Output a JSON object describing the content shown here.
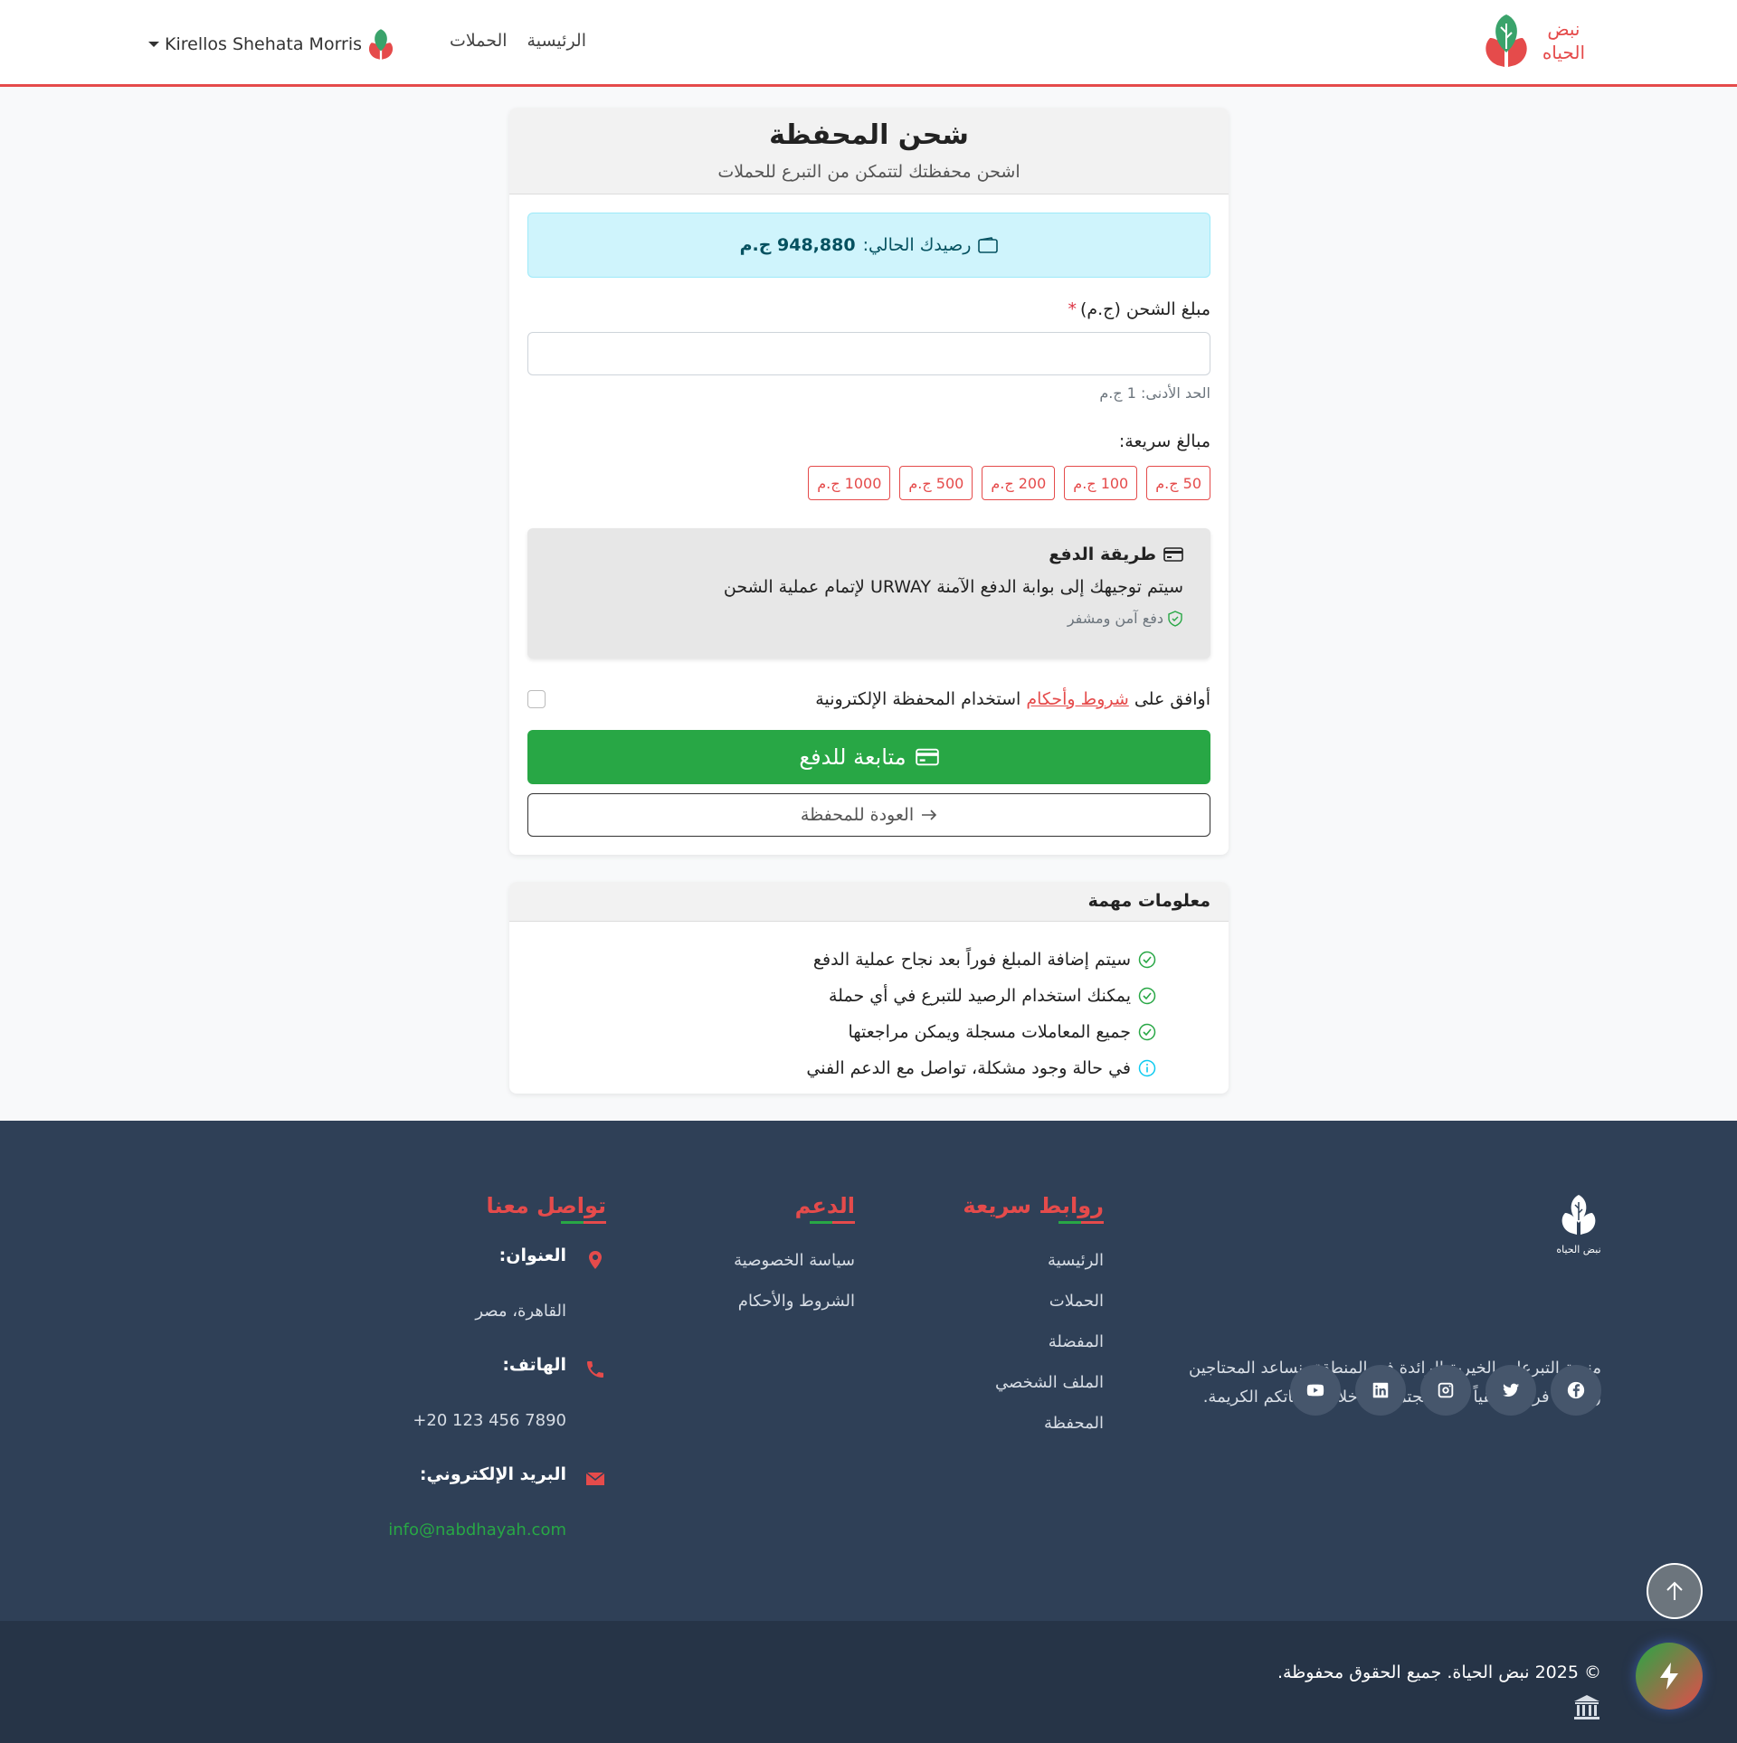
{
  "navbar": {
    "brand_line1": "نبض",
    "brand_line2": "الحياه",
    "links": [
      "الرئيسية",
      "الحملات"
    ],
    "user_name": "Kirellos Shehata Morris"
  },
  "main_card": {
    "title": "شحن المحفظة",
    "subtitle": "اشحن محفظتك لتتمكن من التبرع للحملات",
    "balance_label": "رصيدك الحالي:",
    "balance_value": "948,880 ج.م",
    "amount_label": "مبلغ الشحن (ج.م)",
    "required_mark": "*",
    "amount_value": "",
    "amount_placeholder": "",
    "min_hint": "الحد الأدنى: 1 ج.م",
    "quick_label": "مبالغ سريعة:",
    "quick_amounts": [
      "50 ج.م",
      "100 ج.م",
      "200 ج.م",
      "500 ج.م",
      "1000 ج.م"
    ],
    "payment_title": "طريقة الدفع",
    "payment_desc": "سيتم توجيهك إلى بوابة الدفع الآمنة URWAY لإتمام عملية الشحن",
    "payment_secure": "دفع آمن ومشفر",
    "terms_prefix": "أوافق على",
    "terms_link": "شروط وأحكام",
    "terms_suffix": "استخدام المحفظة الإلكترونية",
    "pay_button": "متابعة للدفع",
    "back_button": "العودة للمحفظة"
  },
  "info_card": {
    "title": "معلومات مهمة",
    "items": [
      "سيتم إضافة المبلغ فوراً بعد نجاح عملية الدفع",
      "يمكنك استخدام الرصيد للتبرع في أي حملة",
      "جميع المعاملات مسجلة ويمكن مراجعتها",
      "في حالة وجود مشكلة، تواصل مع الدعم الفني"
    ],
    "icon_colors": [
      "#28a745",
      "#28a745",
      "#28a745",
      "#0dcaf0"
    ]
  },
  "footer": {
    "logo_text": "نبض الحياه",
    "description": "منصة التبرعات الخيرية الرائدة في المنطقة، نساعد المحتاجين ونحدث فرقاً حقيقياً في المجتمع من خلال تبرعاتكم الكريمة.",
    "socials": [
      "facebook-icon",
      "twitter-icon",
      "instagram-icon",
      "linkedin-icon",
      "youtube-icon"
    ],
    "quick_links_title": "روابط سريعة",
    "quick_links": [
      "الرئيسية",
      "الحملات",
      "المفضلة",
      "الملف الشخصي",
      "المحفظة"
    ],
    "support_title": "الدعم",
    "support_links": [
      "سياسة الخصوصية",
      "الشروط والأحكام"
    ],
    "contact_title": "تواصل معنا",
    "address_label": "العنوان:",
    "address_value": "القاهرة، مصر",
    "phone_label": "الهاتف:",
    "phone_value": "+20 123 456 7890",
    "email_label": "البريد الإلكتروني:",
    "email_value": "info@nabdhayah.com",
    "copyright": "© 2025 نبض الحياة. جميع الحقوق محفوظة."
  },
  "colors": {
    "brand_red": "#e54b4b",
    "brand_green": "#28a745",
    "footer_bg": "#2f4057",
    "info_bg": "#cff4fc"
  }
}
